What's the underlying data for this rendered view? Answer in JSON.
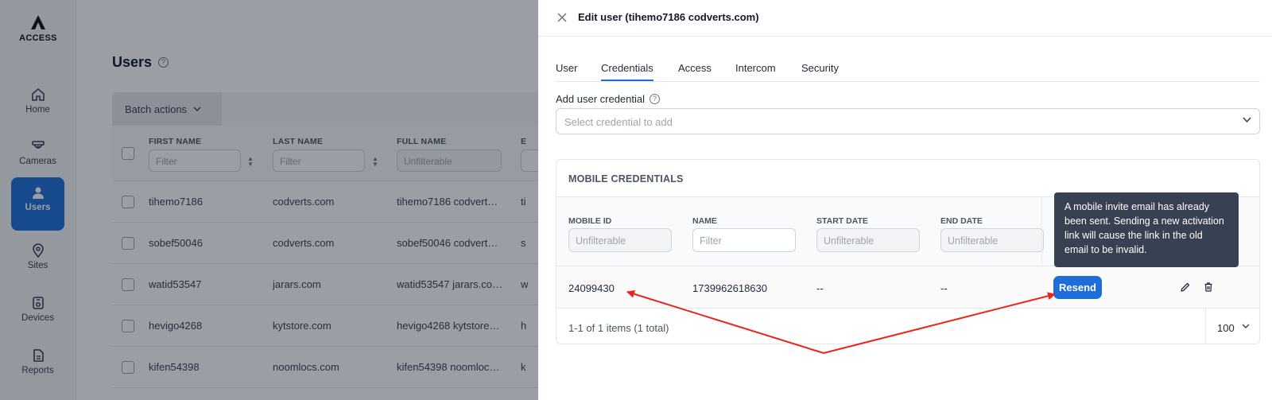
{
  "sidebar": {
    "logo_text": "ACCESS",
    "items": [
      {
        "label": "Home",
        "icon": "home-icon"
      },
      {
        "label": "Cameras",
        "icon": "camera-icon"
      },
      {
        "label": "Users",
        "icon": "user-icon",
        "active": true
      },
      {
        "label": "Sites",
        "icon": "location-pin-icon"
      },
      {
        "label": "Devices",
        "icon": "device-icon"
      },
      {
        "label": "Reports",
        "icon": "report-icon"
      }
    ]
  },
  "users_page": {
    "title": "Users",
    "batch_actions": "Batch actions",
    "columns": [
      {
        "header": "FIRST NAME",
        "filter_placeholder": "Filter"
      },
      {
        "header": "LAST NAME",
        "filter_placeholder": "Filter"
      },
      {
        "header": "FULL NAME",
        "filter_placeholder": "Unfilterable"
      },
      {
        "header": "E"
      }
    ],
    "rows": [
      {
        "first": "tihemo7186",
        "last": "codverts.com",
        "full": "tihemo7186 codvert…",
        "extra": "ti"
      },
      {
        "first": "sobef50046",
        "last": "codverts.com",
        "full": "sobef50046 codvert…",
        "extra": "s"
      },
      {
        "first": "watid53547",
        "last": "jarars.com",
        "full": "watid53547 jarars.co…",
        "extra": "w"
      },
      {
        "first": "hevigo4268",
        "last": "kytstore.com",
        "full": "hevigo4268 kytstore…",
        "extra": "h"
      },
      {
        "first": "kifen54398",
        "last": "noomlocs.com",
        "full": "kifen54398 noomloc…",
        "extra": "k"
      }
    ]
  },
  "drawer": {
    "title": "Edit user (tihemo7186 codverts.com)",
    "tabs": [
      "User",
      "Credentials",
      "Access",
      "Intercom",
      "Security"
    ],
    "active_tab": "Credentials",
    "add_credential_label": "Add user credential",
    "select_placeholder": "Select credential to add",
    "mobile_credentials": {
      "title": "MOBILE CREDENTIALS",
      "columns": [
        {
          "header": "MOBILE ID",
          "filter_placeholder": "Unfilterable"
        },
        {
          "header": "NAME",
          "filter_placeholder": "Filter"
        },
        {
          "header": "START DATE",
          "filter_placeholder": "Unfilterable"
        },
        {
          "header": "END DATE",
          "filter_placeholder": "Unfilterable"
        }
      ],
      "row": {
        "mobile_id": "24099430",
        "name": "1739962618630",
        "start_date": "--",
        "end_date": "--"
      },
      "resend_label": "Resend",
      "pagination_text": "1-1 of 1 items (1 total)",
      "page_size": "100"
    },
    "tooltip": "A mobile invite email has already been sent. Sending a new activation link will cause the link in the old email to be invalid."
  },
  "colors": {
    "accent": "#1d6ed8",
    "annotation_arrow": "#e8261c",
    "tooltip_bg": "#374151"
  }
}
